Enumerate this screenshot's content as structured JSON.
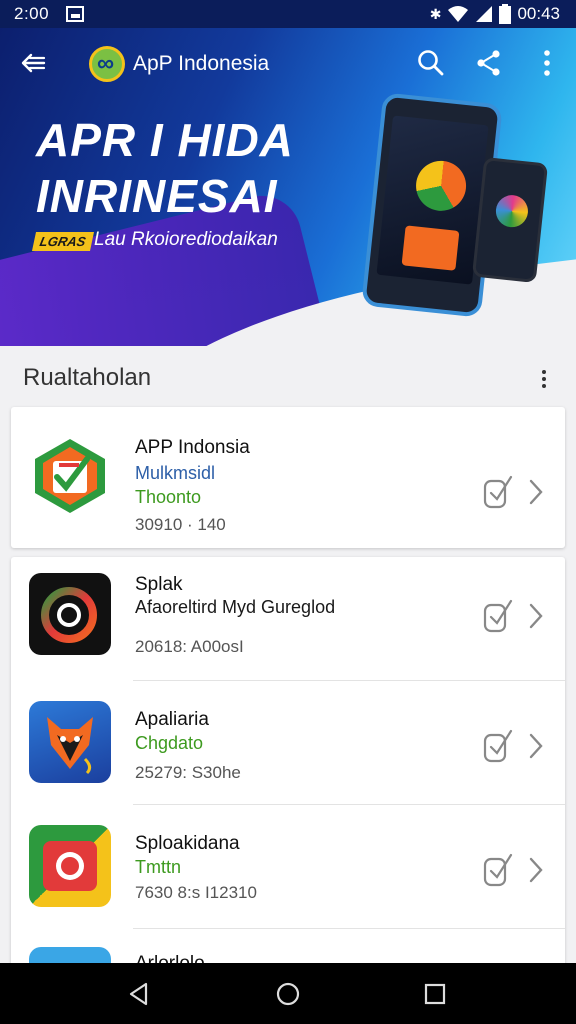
{
  "status_bar": {
    "time_left": "2:00",
    "time_right": "00:43"
  },
  "header": {
    "app_name": "ApP Indonesia"
  },
  "hero": {
    "title_line1": "APR I HIDA",
    "title_line2": "INRINESAI",
    "badge": "LGRAS",
    "subtitle": "Lau Rkoiorediodaikan"
  },
  "section": {
    "title": "Rualtaholan"
  },
  "apps": [
    {
      "name": "APP Indonsia",
      "line2": "Mulkmsidl",
      "line2_color": "blue",
      "line3": "Thoonto",
      "line3_color": "green",
      "line4": "30910 · 140"
    },
    {
      "name": "Splak",
      "line2": "Afaoreltird Myd Gureglod",
      "line2_color": "dark",
      "line3": "20618: A00osI"
    },
    {
      "name": "Apaliaria",
      "line2": "Chgdato",
      "line2_color": "green",
      "line3": "25279: S30he"
    },
    {
      "name": "Sploakidana",
      "line2": "Tmttn",
      "line2_color": "green",
      "line3": "7630 8:s I12310"
    },
    {
      "name": "Arlorlolo"
    }
  ],
  "colors": {
    "accent_blue": "#2d5fa8",
    "accent_green": "#3d9a1f",
    "status_bar": "#0b1d5a"
  },
  "icons": [
    "back-arrow-icon",
    "search-icon",
    "share-icon",
    "more-vert-icon",
    "download-icon",
    "chevron-right-icon",
    "nav-back-icon",
    "nav-home-icon",
    "nav-recents-icon"
  ]
}
